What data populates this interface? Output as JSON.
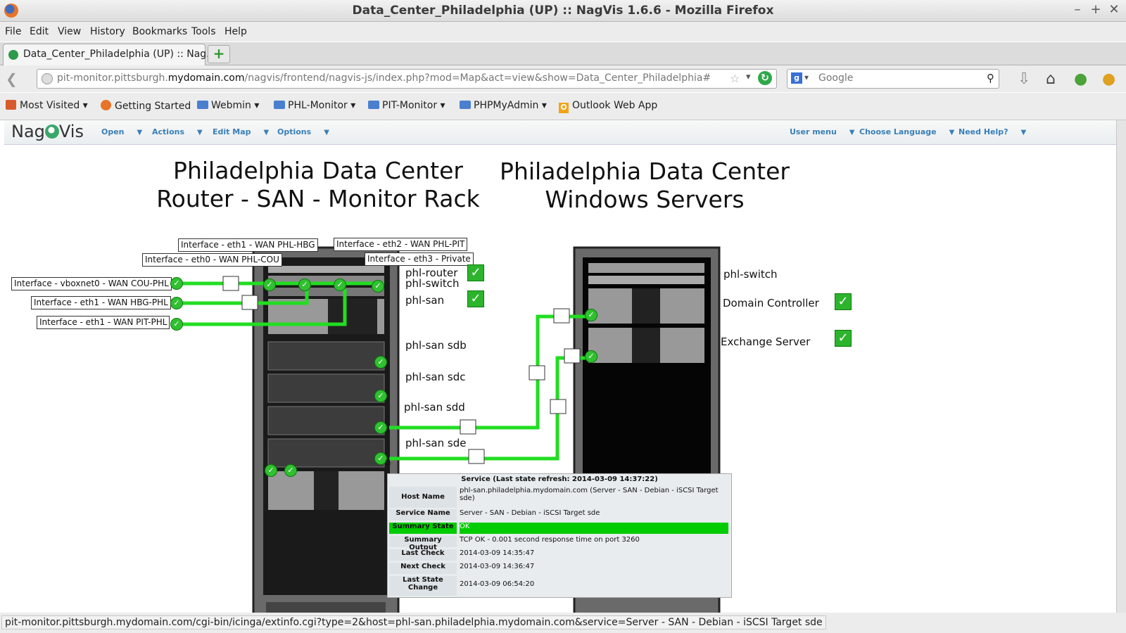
{
  "window": {
    "title": "Data_Center_Philadelphia (UP) :: NagVis 1.6.6 - Mozilla Firefox"
  },
  "menubar": [
    "File",
    "Edit",
    "View",
    "History",
    "Bookmarks",
    "Tools",
    "Help"
  ],
  "tab": {
    "label": "Data_Center_Philadelphia (UP) :: Nag..."
  },
  "url": {
    "pre": "pit-monitor.pittsburgh.",
    "domain": "mydomain.com",
    "path": "/nagvis/frontend/nagvis-js/index.php?mod=Map&act=view&show=Data_Center_Philadelphia#"
  },
  "search": {
    "value": "Google"
  },
  "bookmarks": [
    "Most Visited",
    "Getting Started",
    "Webmin",
    "PHL-Monitor",
    "PIT-Monitor",
    "PHPMyAdmin",
    "Outlook Web App"
  ],
  "nagvis": {
    "logo_left": "Nag",
    "logo_right": "Vis",
    "menu_left": [
      "Open",
      "Actions",
      "Edit Map",
      "Options"
    ],
    "menu_right": [
      "User menu",
      "Choose Language",
      "Need Help?"
    ]
  },
  "map": {
    "title_left": [
      "Philadelphia Data Center",
      "Router - SAN - Monitor Rack"
    ],
    "title_right": [
      "Philadelphia Data Center",
      "Windows Servers"
    ],
    "iface_labels": {
      "eth1_hbg": "Interface - eth1 - WAN PHL-HBG",
      "eth2_pit": "Interface - eth2 - WAN PHL-PIT",
      "eth0_cou": "Interface - eth0 - WAN PHL-COU",
      "eth3_private": "Interface - eth3 - Private",
      "vboxnet0": "Interface - vboxnet0 - WAN COU-PHL",
      "eth1_hbg_phl": "Interface - eth1 - WAN HBG-PHL",
      "eth1_pit_phl": "Interface - eth1 - WAN PIT-PHL"
    },
    "left_hosts": [
      "phl-router",
      "phl-switch",
      "phl-san"
    ],
    "san_services": [
      "phl-san sdb",
      "phl-san sdc",
      "phl-san sdd",
      "phl-san sde"
    ],
    "right_hosts": [
      "phl-switch",
      "Domain Controller",
      "Exchange Server"
    ]
  },
  "hover": {
    "header": "Service (Last state refresh: 2014-03-09 14:37:22)",
    "rows": [
      {
        "k": "Host Name",
        "v": "phl-san.philadelphia.mydomain.com (Server - SAN - Debian - iSCSI Target sde)"
      },
      {
        "k": "Service Name",
        "v": "Server - SAN - Debian - iSCSI Target sde"
      },
      {
        "k": "Summary State",
        "v": "OK"
      },
      {
        "k": "Summary Output",
        "v": "TCP OK - 0.001 second response time on port 3260"
      },
      {
        "k": "Last Check",
        "v": "2014-03-09 14:35:47"
      },
      {
        "k": "Next Check",
        "v": "2014-03-09 14:36:47"
      },
      {
        "k": "Last State Change",
        "v": "2014-03-09 06:54:20"
      }
    ],
    "ok_color": "#00cc00"
  },
  "status": {
    "text": "pit-monitor.pittsburgh.mydomain.com/cgi-bin/icinga/extinfo.cgi?type=2&host=phl-san.philadelphia.mydomain.com&service=Server - SAN - Debian - iSCSI Target sde"
  },
  "colors": {
    "link_line": "#22dd22",
    "nav_menu": "#3a7fb8"
  }
}
